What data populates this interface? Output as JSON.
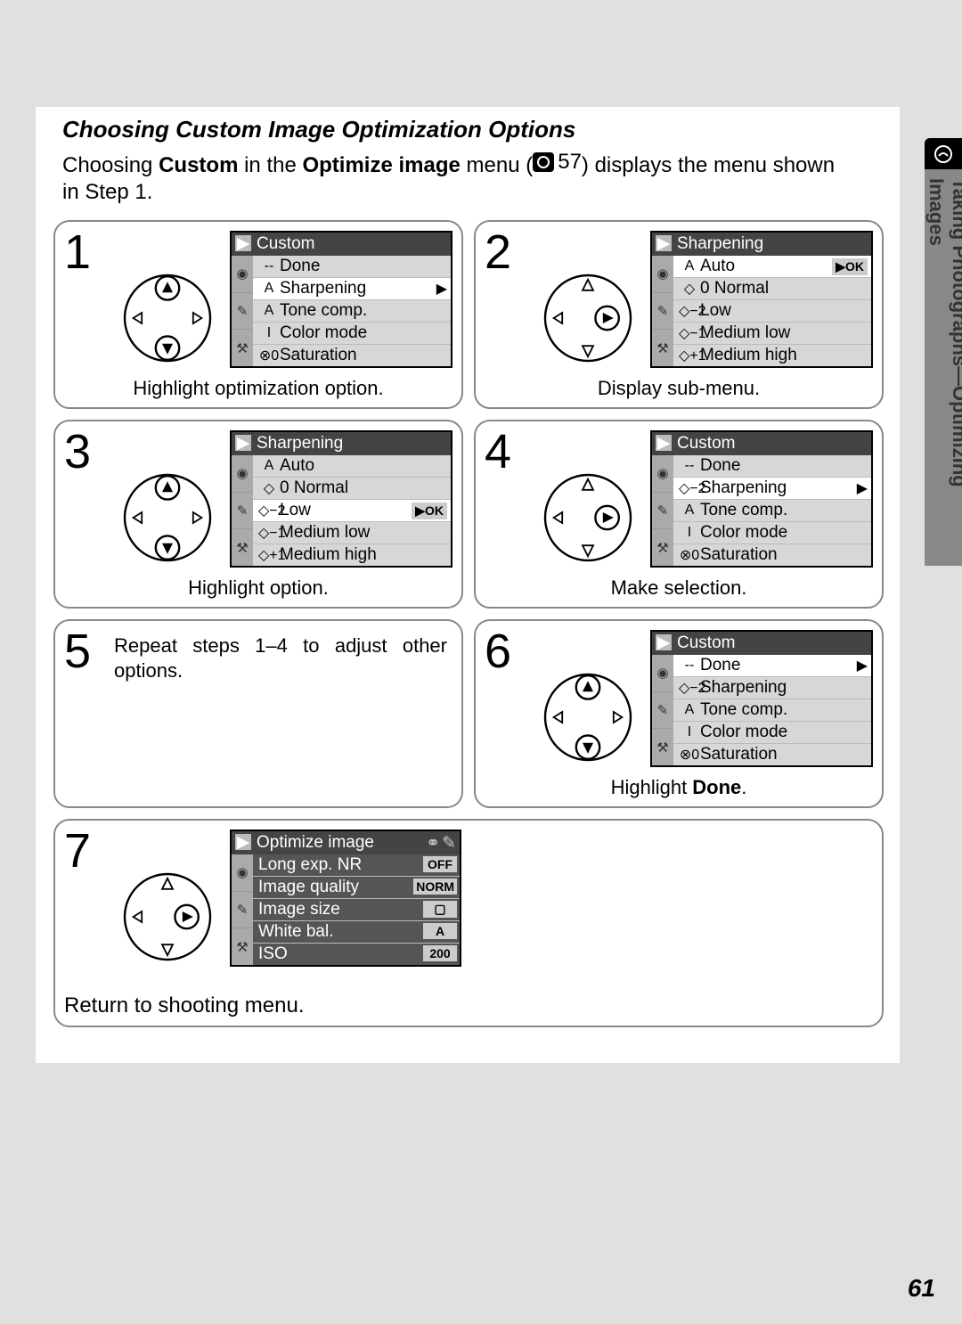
{
  "heading": "Choosing Custom Image Optimization Options",
  "intro": {
    "pre": "Choosing ",
    "b1": "Custom",
    "mid1": " in the ",
    "b2": "Optimize image",
    "mid2": " menu (",
    "ref_page": "57",
    "post": ") displays the menu shown in Step 1."
  },
  "sidebar": "Taking Photographs—Optimizing Images",
  "page_number": "61",
  "steps": {
    "1": {
      "num": "1",
      "caption": "Highlight optimization option.",
      "menu": {
        "title": "Custom",
        "items": [
          {
            "ic": "--",
            "txt": "Done"
          },
          {
            "ic": "A",
            "txt": "Sharpening",
            "sel": true,
            "arrow": true
          },
          {
            "ic": "A",
            "txt": "Tone comp."
          },
          {
            "ic": "I",
            "txt": "Color mode"
          },
          {
            "ic": "⊗0",
            "txt": "Saturation"
          }
        ]
      },
      "dpad": "updown"
    },
    "2": {
      "num": "2",
      "caption": "Display sub-menu.",
      "menu": {
        "title": "Sharpening",
        "items": [
          {
            "ic": "A",
            "txt": "Auto",
            "sel": true,
            "ok": true
          },
          {
            "ic": "◇",
            "txt": "0 Normal"
          },
          {
            "ic": "◇−2",
            "txt": "Low"
          },
          {
            "ic": "◇−1",
            "txt": "Medium low"
          },
          {
            "ic": "◇+1",
            "txt": "Medium high"
          }
        ]
      },
      "dpad": "right"
    },
    "3": {
      "num": "3",
      "caption": "Highlight option.",
      "menu": {
        "title": "Sharpening",
        "items": [
          {
            "ic": "A",
            "txt": "Auto"
          },
          {
            "ic": "◇",
            "txt": "0 Normal"
          },
          {
            "ic": "◇−2",
            "txt": "Low",
            "sel": true,
            "ok": true
          },
          {
            "ic": "◇−1",
            "txt": "Medium low"
          },
          {
            "ic": "◇+1",
            "txt": "Medium high"
          }
        ]
      },
      "dpad": "updown"
    },
    "4": {
      "num": "4",
      "caption": "Make selection.",
      "menu": {
        "title": "Custom",
        "items": [
          {
            "ic": "--",
            "txt": "Done"
          },
          {
            "ic": "◇−2",
            "txt": "Sharpening",
            "sel": true,
            "arrow": true
          },
          {
            "ic": "A",
            "txt": "Tone comp."
          },
          {
            "ic": "I",
            "txt": "Color mode"
          },
          {
            "ic": "⊗0",
            "txt": "Saturation"
          }
        ]
      },
      "dpad": "right"
    },
    "5": {
      "num": "5",
      "text": "Repeat steps 1–4 to adjust other options."
    },
    "6": {
      "num": "6",
      "caption_pre": "Highlight ",
      "caption_b": "Done",
      "caption_post": ".",
      "menu": {
        "title": "Custom",
        "items": [
          {
            "ic": "--",
            "txt": "Done",
            "sel": true,
            "arrow": true
          },
          {
            "ic": "◇−2",
            "txt": "Sharpening"
          },
          {
            "ic": "A",
            "txt": "Tone comp."
          },
          {
            "ic": "I",
            "txt": "Color mode"
          },
          {
            "ic": "⊗0",
            "txt": "Saturation"
          }
        ]
      },
      "dpad": "updown"
    },
    "7": {
      "num": "7",
      "right_text": "Return to shooting menu.",
      "menu": {
        "title": "Optimize image",
        "title_icons": true,
        "dark": true,
        "items": [
          {
            "txt": "Long exp. NR",
            "badge": "OFF"
          },
          {
            "txt": "Image quality",
            "badge": "NORM"
          },
          {
            "txt": "Image size",
            "badge": "▢"
          },
          {
            "txt": "White bal.",
            "badge": "A"
          },
          {
            "txt": "ISO",
            "badge": "200"
          }
        ]
      },
      "dpad": "right"
    }
  }
}
